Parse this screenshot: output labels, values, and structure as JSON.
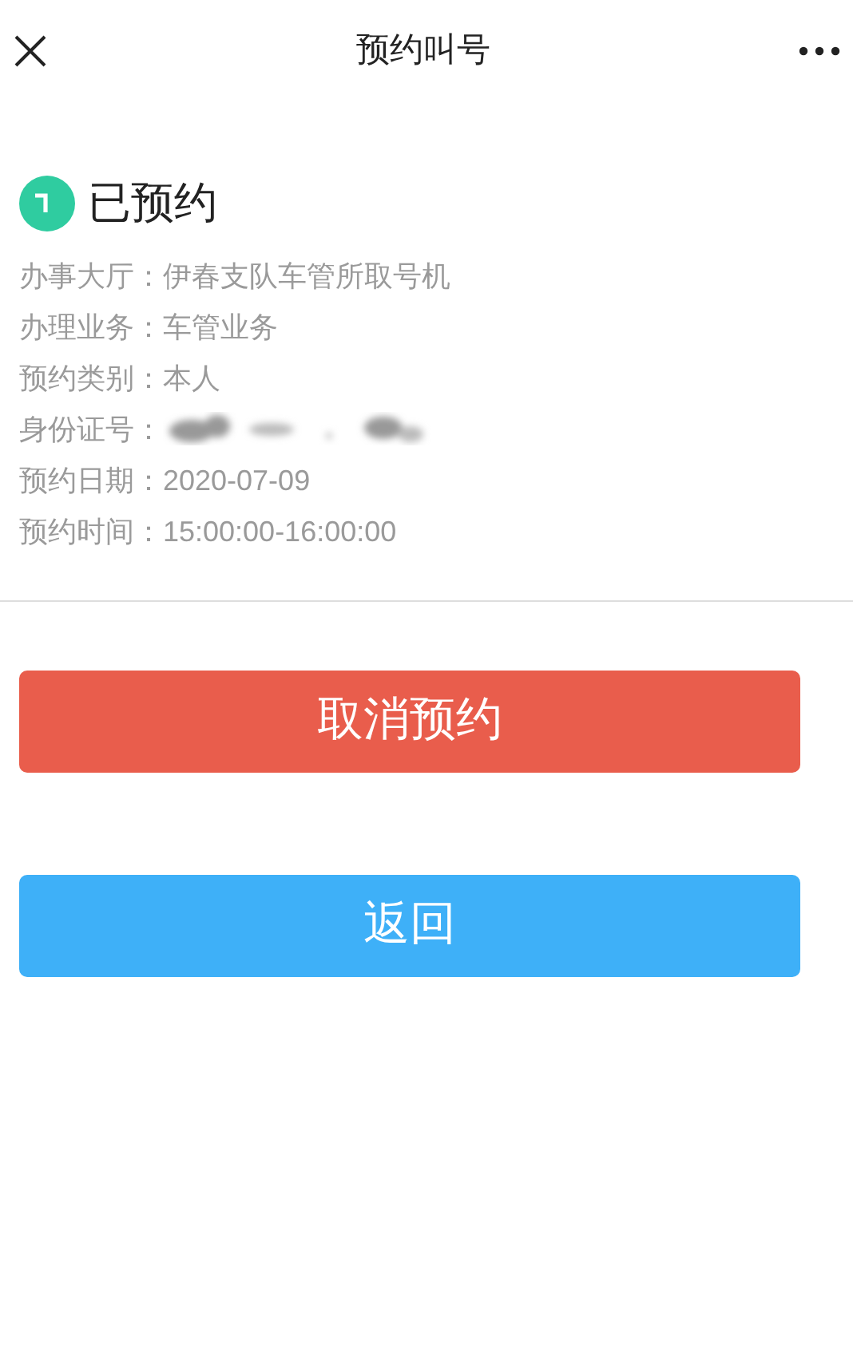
{
  "header": {
    "title": "预约叫号"
  },
  "status": {
    "text": "已预约"
  },
  "details": [
    {
      "label": "办事大厅：",
      "value": "伊春支队车管所取号机"
    },
    {
      "label": "办理业务：",
      "value": "车管业务"
    },
    {
      "label": "预约类别：",
      "value": "本人"
    },
    {
      "label": "身份证号：",
      "redacted": true
    },
    {
      "label": "预约日期：",
      "value": "2020-07-09"
    },
    {
      "label": "预约时间：",
      "value": "15:00:00-16:00:00"
    }
  ],
  "buttons": [
    {
      "label": "取消预约",
      "kind": "danger"
    },
    {
      "label": "返回",
      "kind": "primary"
    }
  ]
}
